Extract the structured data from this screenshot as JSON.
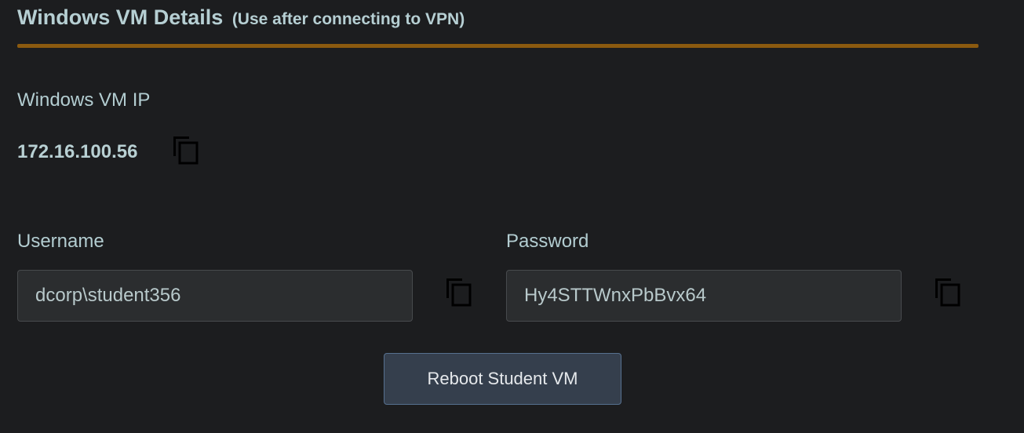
{
  "section": {
    "title": "Windows VM Details",
    "subtitle": "(Use after connecting to VPN)"
  },
  "vm_ip": {
    "label": "Windows VM IP",
    "value": "172.16.100.56"
  },
  "credentials": {
    "username_label": "Username",
    "username_value": "dcorp\\student356",
    "password_label": "Password",
    "password_value": "Hy4STTWnxPbBvx64"
  },
  "actions": {
    "reboot_label": "Reboot Student VM"
  },
  "icons": {
    "copy": "copy-icon"
  },
  "colors": {
    "background": "#1c1d1f",
    "text": "#b8d0d3",
    "accent_rule": "#8b5a0f",
    "field_bg": "#2b2d2f",
    "button_bg": "#353f4d",
    "button_border": "#56708f"
  }
}
